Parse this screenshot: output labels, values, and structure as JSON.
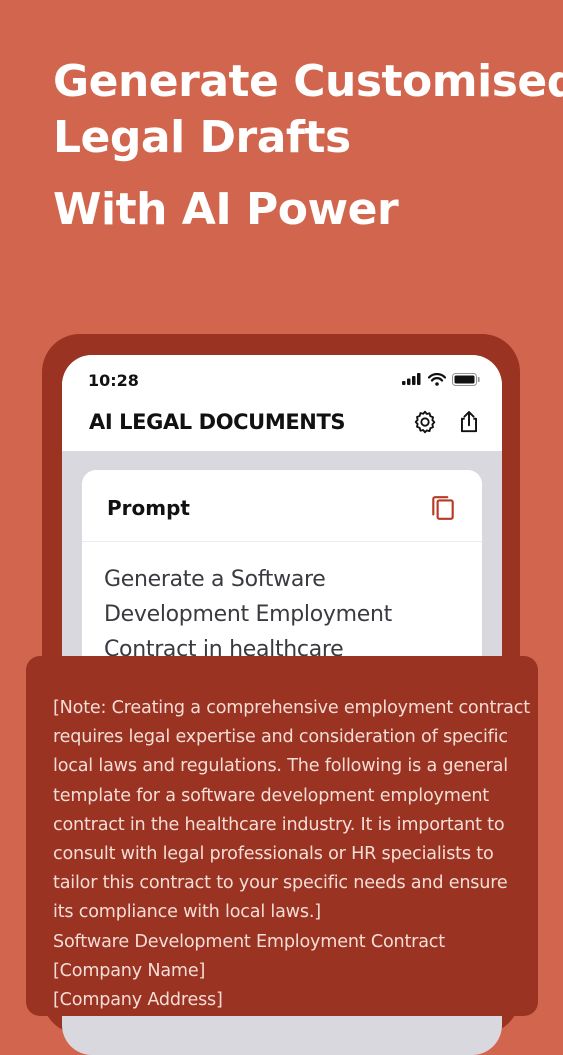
{
  "hero": {
    "line1": "Generate Customised",
    "line2": "Legal Drafts",
    "line3": "With AI Power"
  },
  "status_bar": {
    "time": "10:28"
  },
  "app": {
    "title": "AI LEGAL DOCUMENTS"
  },
  "icons": {
    "settings": "gear-icon",
    "share": "share-icon",
    "copy": "copy-icon",
    "signal": "signal-icon",
    "wifi": "wifi-icon",
    "battery": "battery-icon"
  },
  "prompt_card": {
    "title": "Prompt",
    "text_lines": [
      "Generate a Software",
      "Development Employment",
      "Contract in healthcare"
    ]
  },
  "output": {
    "lines": [
      "[Note: Creating a comprehensive employment contract",
      "requires legal expertise and consideration of specific",
      "local laws and regulations. The following is a general",
      "template for a software development employment",
      "contract in the healthcare industry. It is important to",
      "consult with legal professionals or HR specialists to",
      "tailor this contract to your specific needs and ensure",
      "its compliance with local laws.]",
      "Software Development Employment Contract",
      "[Company Name]",
      "[Company Address]"
    ]
  },
  "colors": {
    "background": "#D2654D",
    "phone_frame": "#9A3322",
    "overlay": "#9A3322",
    "screen_bg": "#D9D8DE",
    "copy_icon": "#B83A25"
  }
}
